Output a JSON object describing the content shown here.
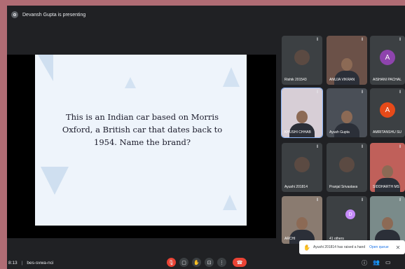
{
  "topbar": {
    "presenter_text": "Devansh Gupta is presenting"
  },
  "slide": {
    "text": "This is an Indian car based on Morris Oxford, a British car that dates back to 1954. Name the brand?"
  },
  "participants": [
    {
      "name": "Rishik 201543",
      "type": "avatar-img",
      "color": "#26282b"
    },
    {
      "name": "ANUJA VIKRAN",
      "type": "video",
      "color": "#6b5148"
    },
    {
      "name": "AISHANI PACHAL",
      "type": "letter",
      "letter": "A",
      "color": "#8e44ad"
    },
    {
      "name": "KHUSHI CHHAB",
      "type": "video",
      "color": "#d7ced6"
    },
    {
      "name": "Ayush Gupta",
      "type": "video",
      "color": "#4a4f57"
    },
    {
      "name": "AMRITANSHU SU",
      "type": "letter",
      "letter": "A",
      "color": "#e64a19"
    },
    {
      "name": "Ayushi 201814",
      "type": "avatar-img",
      "color": "#3c4043"
    },
    {
      "name": "Pranjal Srivastava",
      "type": "avatar-img",
      "color": "#3c4043"
    },
    {
      "name": "SIDDHARTH MS",
      "type": "video",
      "color": "#c0605a"
    },
    {
      "name": "ARCHI",
      "type": "video",
      "color": "#8a7b70"
    },
    {
      "name": "41 others",
      "type": "others",
      "letter": "D",
      "color": "#3c4043"
    },
    {
      "name": "",
      "type": "video",
      "color": "#7a8b8a"
    }
  ],
  "toast": {
    "message": "Ayushi 201814 has raised a hand",
    "action": "Open queue"
  },
  "bottombar": {
    "time": "8:13",
    "meeting_code": "bes-svwa-nci"
  },
  "colors": {
    "end_call": "#ea4335",
    "background": "#202124"
  }
}
